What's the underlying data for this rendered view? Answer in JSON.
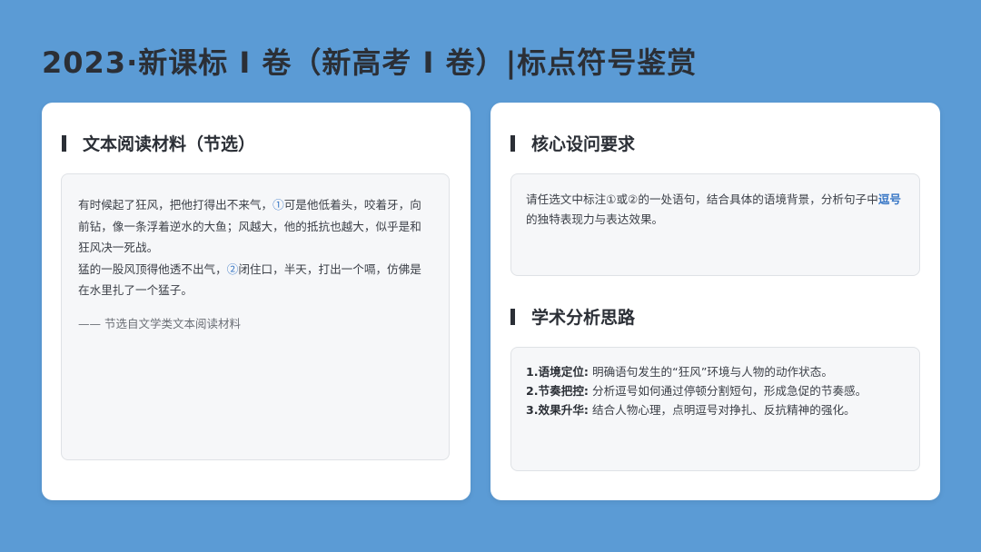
{
  "title": "2023·新课标 I 卷（新高考 I 卷）|标点符号鉴赏",
  "left": {
    "heading": "文本阅读材料（节选）",
    "passage": [
      {
        "pre": "有时候起了狂风，把他打得出不来气，",
        "mark": "①",
        "post": "可是他低着头，咬着牙，向前钻，像一条浮着逆水的大鱼；风越大，他的抵抗也越大，似乎是和狂风决一死战。"
      },
      {
        "pre": "猛的一股风顶得他透不出气，",
        "mark": "②",
        "post": "闭住口，半天，打出一个嗝，仿佛是在水里扎了一个猛子。"
      }
    ],
    "source": "—— 节选自文学类文本阅读材料"
  },
  "right": {
    "requirement_heading": "核心设问要求",
    "requirement_pre": "请任选文中标注①或②的一处语句，结合具体的语境背景，分析句子中",
    "requirement_highlight": "逗号",
    "requirement_post": "的独特表现力与表达效果。",
    "analysis_heading": "学术分析思路",
    "steps": [
      {
        "label": "1.语境定位:",
        "text": "明确语句发生的“狂风”环境与人物的动作状态。"
      },
      {
        "label": "2.节奏把控:",
        "text": "分析逗号如何通过停顿分割短句，形成急促的节奏感。"
      },
      {
        "label": "3.效果升华:",
        "text": "结合人物心理，点明逗号对挣扎、反抗精神的强化。"
      }
    ]
  }
}
